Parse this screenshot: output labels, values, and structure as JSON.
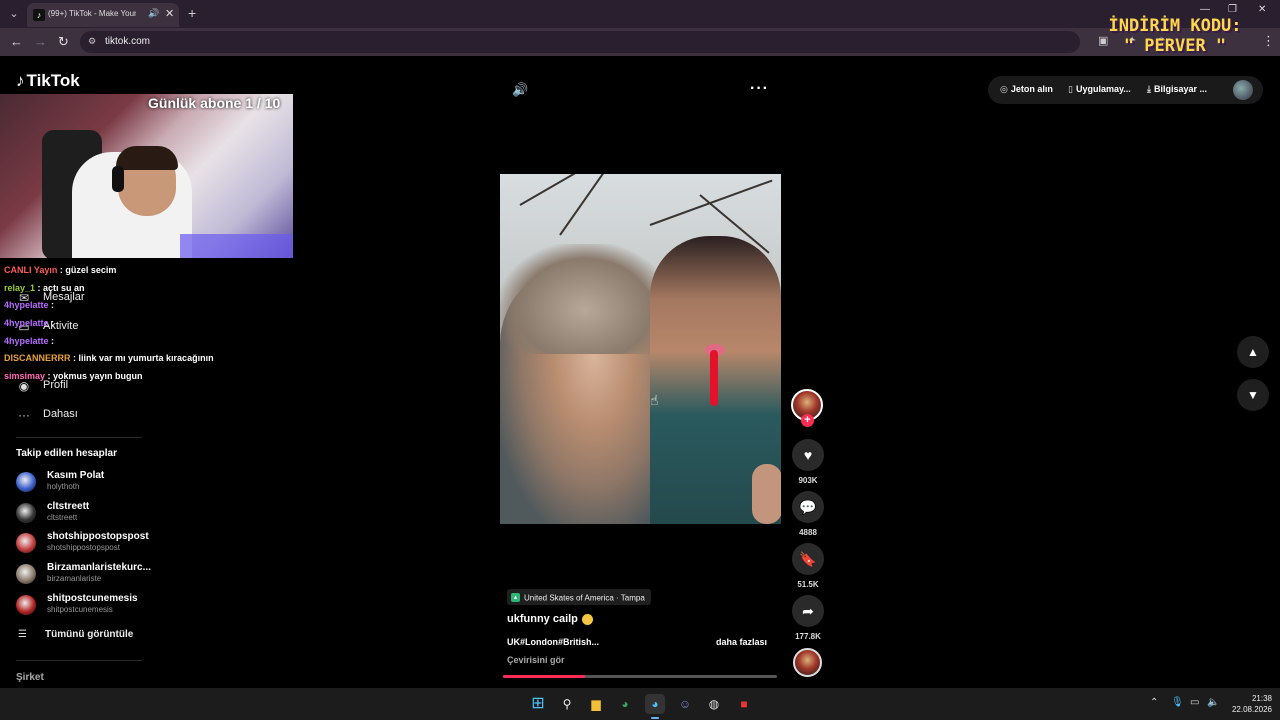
{
  "browser": {
    "tab_title": "(99+) TikTok - Make Your Day",
    "url": "tiktok.com"
  },
  "overlay": {
    "promo_line1": "İNDİRİM KODU:",
    "promo_line2": "\" PERVER \"",
    "sub_goal": "Günlük abone 1 / 10"
  },
  "chat": [
    {
      "user": "CANLI Yayın",
      "text": ": güzel secim",
      "color": "#ff5a5a"
    },
    {
      "user": "relay_1",
      "text": ": açtı su an",
      "color": "#9acd32"
    },
    {
      "user": "4hypelatte",
      "text": ":",
      "color": "#b56cff"
    },
    {
      "user": "4hypelatte",
      "text": ":",
      "color": "#b56cff"
    },
    {
      "user": "4hypelatte",
      "text": ":",
      "color": "#b56cff"
    },
    {
      "user": "DISCANNERRR",
      "text": ": liink var mı yumurta kıracağının",
      "color": "#e8a33d"
    },
    {
      "user": "simsimay",
      "text": ": yokmus yayın bugun",
      "color": "#ff6bb5"
    }
  ],
  "tiktok": {
    "logo": "TikTok",
    "nav": {
      "messages": "Mesajlar",
      "activity": "Aktivite",
      "profile": "Profil",
      "more": "Dahası"
    },
    "following_title": "Takip edilen hesaplar",
    "following": [
      {
        "name": "Kasım Polat",
        "handle": "holythoth",
        "color": "#3a5fcd"
      },
      {
        "name": "cltstreett",
        "handle": "cltstreett",
        "color": "#333333"
      },
      {
        "name": "shotshippostopspost",
        "handle": "shotshippostopspost",
        "color": "#c23b3b"
      },
      {
        "name": "Birzamanlaristekurc...",
        "handle": "birzamanlariste",
        "color": "#8a7a6a"
      },
      {
        "name": "shitpostcunemesis",
        "handle": "shitpostcunemesis",
        "color": "#b22222"
      }
    ],
    "see_all": "Tümünü görüntüle",
    "company": "Şirket",
    "top_actions": {
      "coins": "Jeton alın",
      "app": "Uygulamay...",
      "desktop": "Bilgisayar ..."
    }
  },
  "video": {
    "location": "United Skates of America · Tampa",
    "username": "ukfunny cailp",
    "description": "UK#London#British...",
    "more": "daha fazlası",
    "translate": "Çevirisini gör",
    "progress": 0.3,
    "likes": "903K",
    "comments": "4888",
    "saves": "51.5K",
    "shares": "177.8K"
  },
  "taskbar": {
    "time": "21:38",
    "date": "22.08.2026"
  }
}
